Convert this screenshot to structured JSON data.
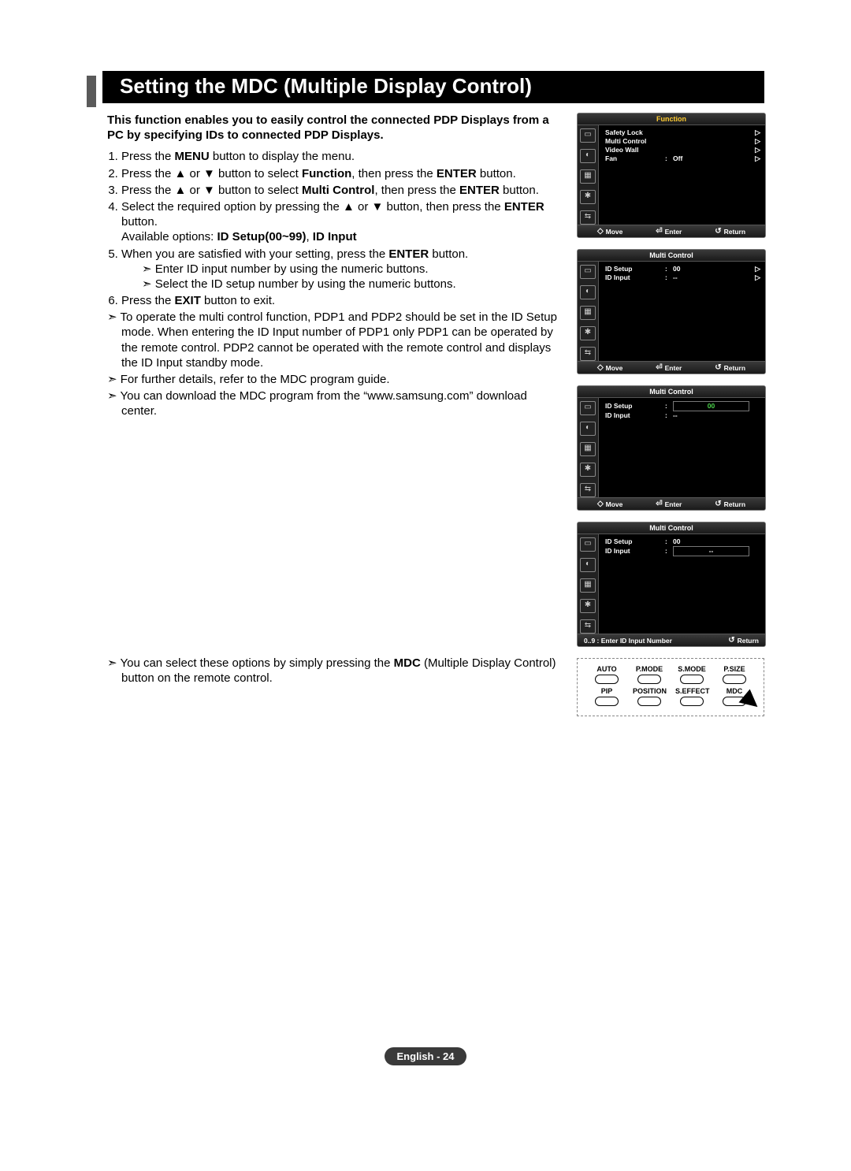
{
  "title": "Setting the MDC (Multiple Display Control)",
  "intro": "This function enables you to easily control the connected PDP Displays from a PC by specifying IDs to connected PDP Displays.",
  "steps": {
    "s1_a": "Press the ",
    "s1_b": "MENU",
    "s1_c": " button to display the menu.",
    "s2_a": "Press the ▲ or ▼ button to select ",
    "s2_b": "Function",
    "s2_c": ", then press the ",
    "s2_d": "ENTER",
    "s2_e": " button.",
    "s3_a": "Press the ▲ or ▼ button to select ",
    "s3_b": "Multi Control",
    "s3_c": ", then press the ",
    "s3_d": "ENTER",
    "s3_e": " button.",
    "s4_a": "Select the required option by pressing the ▲ or ▼ button, then press the ",
    "s4_b": "ENTER",
    "s4_c": " button.",
    "s4_avail_a": "Available options: ",
    "s4_avail_b": "ID Setup(00~99)",
    "s4_avail_c": ", ",
    "s4_avail_d": "ID Input",
    "s5_a": "When you are satisfied with your setting, press the ",
    "s5_b": "ENTER",
    "s5_c": " button.",
    "s5_sub1": "Enter ID input number by using the numeric buttons.",
    "s5_sub2": "Select the ID setup number by using the numeric buttons.",
    "s6_a": "Press the ",
    "s6_b": "EXIT",
    "s6_c": " button to exit."
  },
  "notes": {
    "n1": "To operate the multi control function, PDP1 and PDP2 should be set in the ID Setup mode. When entering the ID Input number of PDP1 only PDP1 can be operated by the remote control. PDP2 cannot be operated with the remote control and displays the ID Input standby mode.",
    "n2": "For further details, refer to the MDC program guide.",
    "n3": "You can download the MDC program from the “www.samsung.com” download center.",
    "n4_a": "You can select these options by simply pressing the ",
    "n4_b": "MDC",
    "n4_c": " (Multiple Display Control) button on the remote control."
  },
  "osd": {
    "function_title": "Function",
    "multi_title": "Multi Control",
    "rows_function": [
      {
        "label": "Safety Lock",
        "val": "",
        "arrow": "▷"
      },
      {
        "label": "Multi Control",
        "val": "",
        "arrow": "▷"
      },
      {
        "label": "Video Wall",
        "val": "",
        "arrow": "▷"
      },
      {
        "label": "Fan",
        "val": "Off",
        "arrow": "▷"
      }
    ],
    "rows_mc1": [
      {
        "label": "ID Setup",
        "val": "00",
        "arrow": "▷"
      },
      {
        "label": "ID Input",
        "val": "--",
        "arrow": "▷"
      }
    ],
    "rows_mc2": [
      {
        "label": "ID Setup",
        "val": "00",
        "arrow": "",
        "boxed": true,
        "green": true
      },
      {
        "label": "ID Input",
        "val": "--",
        "arrow": ""
      }
    ],
    "rows_mc3": [
      {
        "label": "ID Setup",
        "val": "00",
        "arrow": ""
      },
      {
        "label": "ID Input",
        "val": "--",
        "arrow": "",
        "boxed": true
      }
    ],
    "footer": {
      "move": "Move",
      "enter": "Enter",
      "ret": "Return",
      "numprompt": "0..9 : Enter ID Input Number"
    }
  },
  "remote": {
    "row1": [
      "AUTO",
      "P.MODE",
      "S.MODE",
      "P.SIZE"
    ],
    "row2": [
      "PIP",
      "POSITION",
      "S.EFFECT",
      "MDC"
    ]
  },
  "footer": {
    "lang": "English - ",
    "page": "24"
  }
}
